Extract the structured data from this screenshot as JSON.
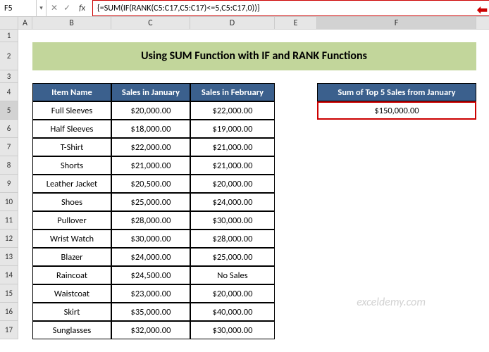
{
  "namebox": {
    "ref": "F5"
  },
  "formula": "{=SUM(IF(RANK(C5:C17,C5:C17)<=5,C5:C17,0))}",
  "fx": "fx",
  "cancel": "✕",
  "confirm": "✓",
  "dropdown": "▾",
  "arrow": "⬅",
  "columns": [
    "A",
    "B",
    "C",
    "D",
    "E",
    "F"
  ],
  "title": "Using SUM Function with IF and RANK Functions",
  "headers": {
    "b": "Item Name",
    "c": "Sales in January",
    "d": "Sales in February"
  },
  "sum": {
    "label": "Sum of Top 5 Sales from January",
    "value": "$150,000.00"
  },
  "rows": [
    {
      "n": "1"
    },
    {
      "n": "2"
    },
    {
      "n": "3"
    },
    {
      "n": "4"
    },
    {
      "n": "5",
      "b": "Full Sleeves",
      "c": "$20,000.00",
      "d": "$22,000.00"
    },
    {
      "n": "6",
      "b": "Half Sleeves",
      "c": "$18,000.00",
      "d": "$19,000.00"
    },
    {
      "n": "7",
      "b": "T-Shirt",
      "c": "$22,000.00",
      "d": "$21,000.00"
    },
    {
      "n": "8",
      "b": "Shorts",
      "c": "$21,000.00",
      "d": "$21,000.00"
    },
    {
      "n": "9",
      "b": "Leather Jacket",
      "c": "$20,500.00",
      "d": "$20,000.00"
    },
    {
      "n": "10",
      "b": "Shoes",
      "c": "$25,000.00",
      "d": "$24,000.00"
    },
    {
      "n": "11",
      "b": "Pullover",
      "c": "$28,000.00",
      "d": "$30,000.00"
    },
    {
      "n": "12",
      "b": "Wrist Watch",
      "c": "$30,000.00",
      "d": "$28,000.00"
    },
    {
      "n": "13",
      "b": "Blazer",
      "c": "$24,000.00",
      "d": "$25,000.00"
    },
    {
      "n": "14",
      "b": "Raincoat",
      "c": "$24,500.00",
      "d": "No Sales"
    },
    {
      "n": "15",
      "b": "Waistcoat",
      "c": "$23,000.00",
      "d": "$20,000.00"
    },
    {
      "n": "16",
      "b": "Skirt",
      "c": "$35,000.00",
      "d": "$40,000.00"
    },
    {
      "n": "17",
      "b": "Sunglasses",
      "c": "$32,000.00",
      "d": "$30,000.00"
    }
  ],
  "watermark": "exceldemy.com"
}
